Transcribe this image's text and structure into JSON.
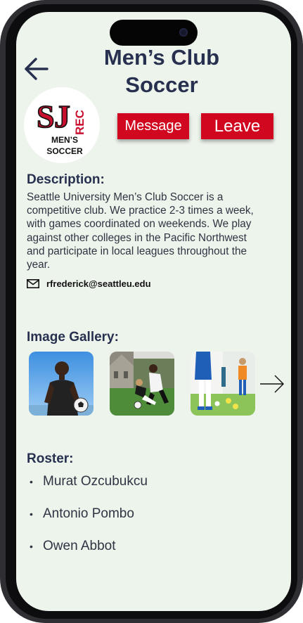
{
  "header": {
    "title_line1": "Men’s Club",
    "title_line2": "Soccer"
  },
  "logo": {
    "letters_s": "S",
    "letters_j": "J",
    "letters_rec": "REC",
    "line1": "MEN’S",
    "line2": "SOCCER"
  },
  "actions": {
    "message_label": "Message",
    "leave_label": "Leave"
  },
  "description": {
    "heading": "Description:",
    "body": "Seattle University Men’s Club Soccer is a competitive club.  We practice 2-3 times a week, with games coordinated on weekends. We play against other colleges in the Pacific Northwest and participate in local leagues throughout the year."
  },
  "contact": {
    "email": "rfrederick@seattleu.edu",
    "icon": "mail-icon"
  },
  "gallery": {
    "heading": "Image Gallery:",
    "next_icon": "arrow-right-icon"
  },
  "roster": {
    "heading": "Roster:",
    "members": [
      "Murat Ozcubukcu",
      "Antonio Pombo",
      "Owen Abbot"
    ]
  },
  "colors": {
    "screen_bg": "#edf4ec",
    "heading": "#27304f",
    "accent_red": "#d0071f"
  }
}
